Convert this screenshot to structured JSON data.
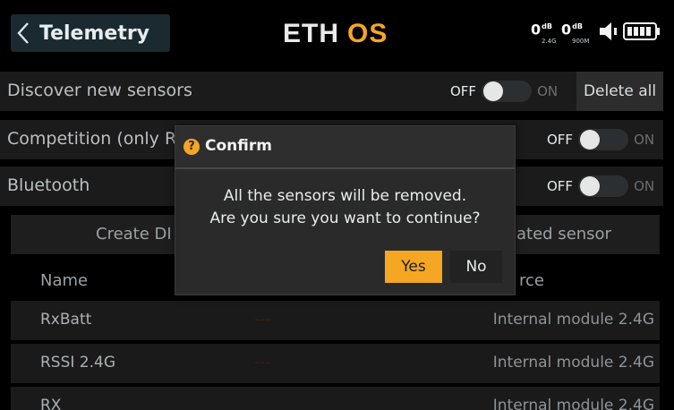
{
  "header": {
    "title": "Telemetry",
    "logo_text": "ETHOS",
    "rssi_24": "0",
    "rssi_24_unit": "dB",
    "rssi_24_band": "2.4G",
    "rssi_900": "0",
    "rssi_900_unit": "dB",
    "rssi_900_band": "900M",
    "icons": [
      "chevron-left-icon",
      "volume-icon",
      "battery-icon"
    ]
  },
  "settings": {
    "discover_label": "Discover new sensors",
    "discover_state": "OFF",
    "discover_alt": "ON",
    "delete_all_label": "Delete all",
    "competition_label": "Competition (only R",
    "competition_state": "OFF",
    "competition_alt": "ON",
    "bluetooth_label": "Bluetooth",
    "bluetooth_state": "OFF",
    "bluetooth_alt": "ON"
  },
  "create": {
    "left_label": "Create DI",
    "right_label": "ated sensor"
  },
  "table": {
    "headers": {
      "name": "Name",
      "source": "rce"
    },
    "rows": [
      {
        "name": "RxBatt",
        "value": "---",
        "source": "Internal module 2.4G"
      },
      {
        "name": "RSSI 2.4G",
        "value": "---",
        "source": "Internal module 2.4G"
      },
      {
        "name": "RX",
        "value": "",
        "source": "Internal module 2.4G"
      }
    ]
  },
  "dialog": {
    "title": "Confirm",
    "icon": "question-icon",
    "line1": "All the sensors will be removed.",
    "line2": "Are you sure you want to continue?",
    "yes_label": "Yes",
    "no_label": "No"
  },
  "colors": {
    "accent": "#f5a623",
    "background": "#000000",
    "row": "#1b1b1b",
    "dialog": "#2a2a2a"
  }
}
